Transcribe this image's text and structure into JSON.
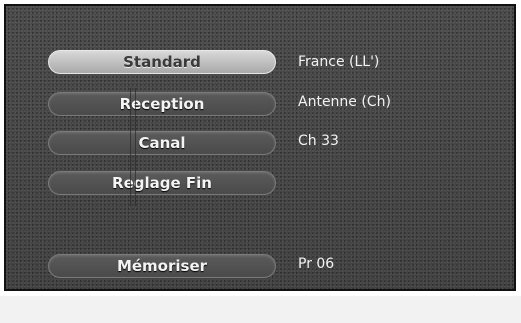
{
  "menu": {
    "items": [
      {
        "label": "Standard",
        "value": "France (LL')",
        "selected": true
      },
      {
        "label": "Reception",
        "value": "Antenne (Ch)",
        "selected": false
      },
      {
        "label": "Canal",
        "value": "Ch 33",
        "selected": false
      },
      {
        "label": "Reglage Fin",
        "value": "",
        "selected": false
      },
      {
        "label": "Mémoriser",
        "value": "Pr 06",
        "selected": false
      }
    ]
  },
  "colors": {
    "panel": "#474747",
    "selected_pill": "#c4c4c4",
    "text": "#f2f2f2"
  }
}
